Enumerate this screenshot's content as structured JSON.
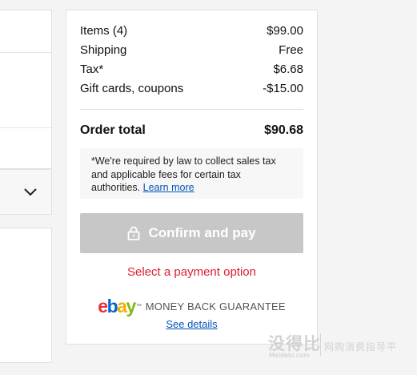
{
  "summary": {
    "items_label": "Items (4)",
    "items_value": "$99.00",
    "shipping_label": "Shipping",
    "shipping_value": "Free",
    "tax_label": "Tax*",
    "tax_value": "$6.68",
    "gift_label": "Gift cards, coupons",
    "gift_value": "-$15.00",
    "total_label": "Order total",
    "total_value": "$90.68",
    "tax_note": "*We're required by law to collect sales tax and applicable fees for certain tax authorities.",
    "learn_more": "Learn more",
    "confirm_label": "Confirm and pay",
    "error_message": "Select a payment option",
    "guarantee_text": "MONEY BACK GUARANTEE",
    "see_details": "See details"
  },
  "logo": {
    "e": "e",
    "b": "b",
    "a": "a",
    "y": "y",
    "tm": "™"
  },
  "watermark": {
    "main": "没得比",
    "sub": "Meidebi.com",
    "side": "网购消费指导平"
  },
  "icons": {
    "dropdown": "chevron-down-icon",
    "lock": "lock-icon"
  },
  "colors": {
    "link": "#0654ba",
    "error": "#dd1e31",
    "button_disabled": "#c7c7c7"
  }
}
